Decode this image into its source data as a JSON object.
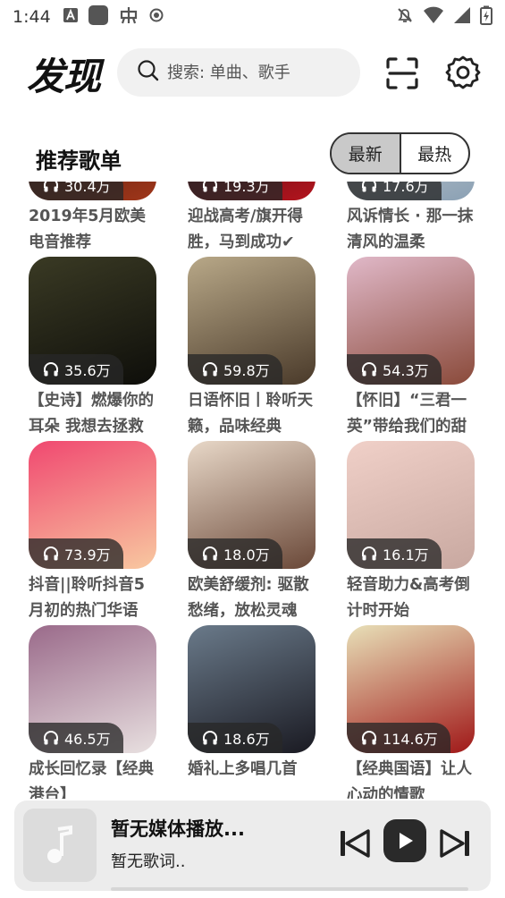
{
  "status_bar": {
    "time": "1:44",
    "left_icons": [
      "a-icon",
      "app-square-icon",
      "bug-icon",
      "record-icon"
    ],
    "right_icons": [
      "mute-bell-icon",
      "wifi-icon",
      "signal-icon",
      "battery-charging-icon"
    ]
  },
  "header": {
    "title": "发现",
    "search_placeholder": "搜索: 单曲、歌手",
    "scan_icon": "scan-icon",
    "settings_icon": "settings-gear-icon"
  },
  "section": {
    "title": "推荐歌单",
    "tabs": [
      {
        "label": "最新",
        "active": true
      },
      {
        "label": "最热",
        "active": false
      }
    ]
  },
  "playlists": [
    {
      "plays": "30.4万",
      "title": "2019年5月欧美电音推荐",
      "colors": [
        "#2a1008",
        "#a0361a"
      ]
    },
    {
      "plays": "19.3万",
      "title": "迎战高考/旗开得胜，马到成功✔",
      "colors": [
        "#1a0a0a",
        "#b4141e"
      ]
    },
    {
      "plays": "17.6万",
      "title": "风诉情长 · 那一抹清风的温柔",
      "colors": [
        "#e8e4dc",
        "#8aa0b4"
      ]
    },
    {
      "plays": "35.6万",
      "title": "【史诗】燃爆你的耳朵 我想去拯救世界",
      "colors": [
        "#3a3a24",
        "#0e0e0a"
      ]
    },
    {
      "plays": "59.8万",
      "title": "日语怀旧丨聆听天籁，品味经典",
      "colors": [
        "#b8a888",
        "#4a3a2a"
      ]
    },
    {
      "plays": "54.3万",
      "title": "【怀旧】“三君一英”带给我们的甜蜜",
      "colors": [
        "#e0b8c8",
        "#8a4a3a"
      ]
    },
    {
      "plays": "73.9万",
      "title": "抖音||聆听抖音5月初的热门华语",
      "colors": [
        "#f04870",
        "#f8c8a0"
      ]
    },
    {
      "plays": "18.0万",
      "title": "欧美舒缓剂: 驱散愁绪，放松灵魂",
      "colors": [
        "#e8d8c8",
        "#6a4838"
      ]
    },
    {
      "plays": "16.1万",
      "title": "轻音助力&高考倒计时开始",
      "colors": [
        "#f0d0c8",
        "#c8a8a0"
      ]
    },
    {
      "plays": "46.5万",
      "title": "成长回忆录【经典港台】",
      "colors": [
        "#9a6a8a",
        "#e8e0e0"
      ]
    },
    {
      "plays": "18.6万",
      "title": "婚礼上多唱几首",
      "colors": [
        "#6a7a8a",
        "#1a1a22"
      ]
    },
    {
      "plays": "114.6万",
      "title": "【经典国语】让人心动的情歌",
      "colors": [
        "#e8e0b8",
        "#a01818"
      ]
    }
  ],
  "player": {
    "title": "暂无媒体播放...",
    "lyric": "暂无歌词..",
    "progress": 0.0,
    "art_icon": "music-note-icon",
    "prev_icon": "skip-previous-icon",
    "play_icon": "play-icon",
    "next_icon": "skip-next-icon"
  }
}
